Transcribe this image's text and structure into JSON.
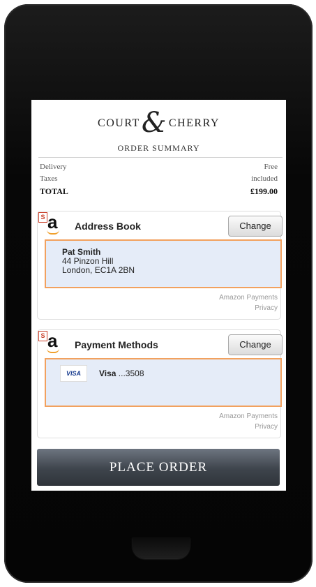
{
  "brand": {
    "part1": "COURT",
    "amp": "&",
    "part2": "CHERRY"
  },
  "summary": {
    "title": "ORDER SUMMARY",
    "lines": [
      {
        "label": "Delivery",
        "value": "Free"
      },
      {
        "label": "Taxes",
        "value": "included"
      }
    ],
    "total": {
      "label": "TOTAL",
      "value": "£199.00"
    }
  },
  "address_widget": {
    "badge": "S",
    "logo": "a",
    "title": "Address Book",
    "change_label": "Change",
    "name": "Pat Smith",
    "street": "44 Pinzon Hill",
    "city": "London, EC1A 2BN",
    "footer_line1": "Amazon Payments",
    "footer_line2": "Privacy"
  },
  "payment_widget": {
    "badge": "S",
    "logo": "a",
    "title": "Payment Methods",
    "change_label": "Change",
    "card_logo": "VISA",
    "card_brand": "Visa",
    "card_number": " ...3508",
    "footer_line1": "Amazon Payments",
    "footer_line2": "Privacy"
  },
  "place_order_label": "PLACE ORDER",
  "colors": {
    "accent_border": "#f2a15e",
    "box_bg": "#e5ecf8",
    "button_bg": "#3e444c"
  }
}
